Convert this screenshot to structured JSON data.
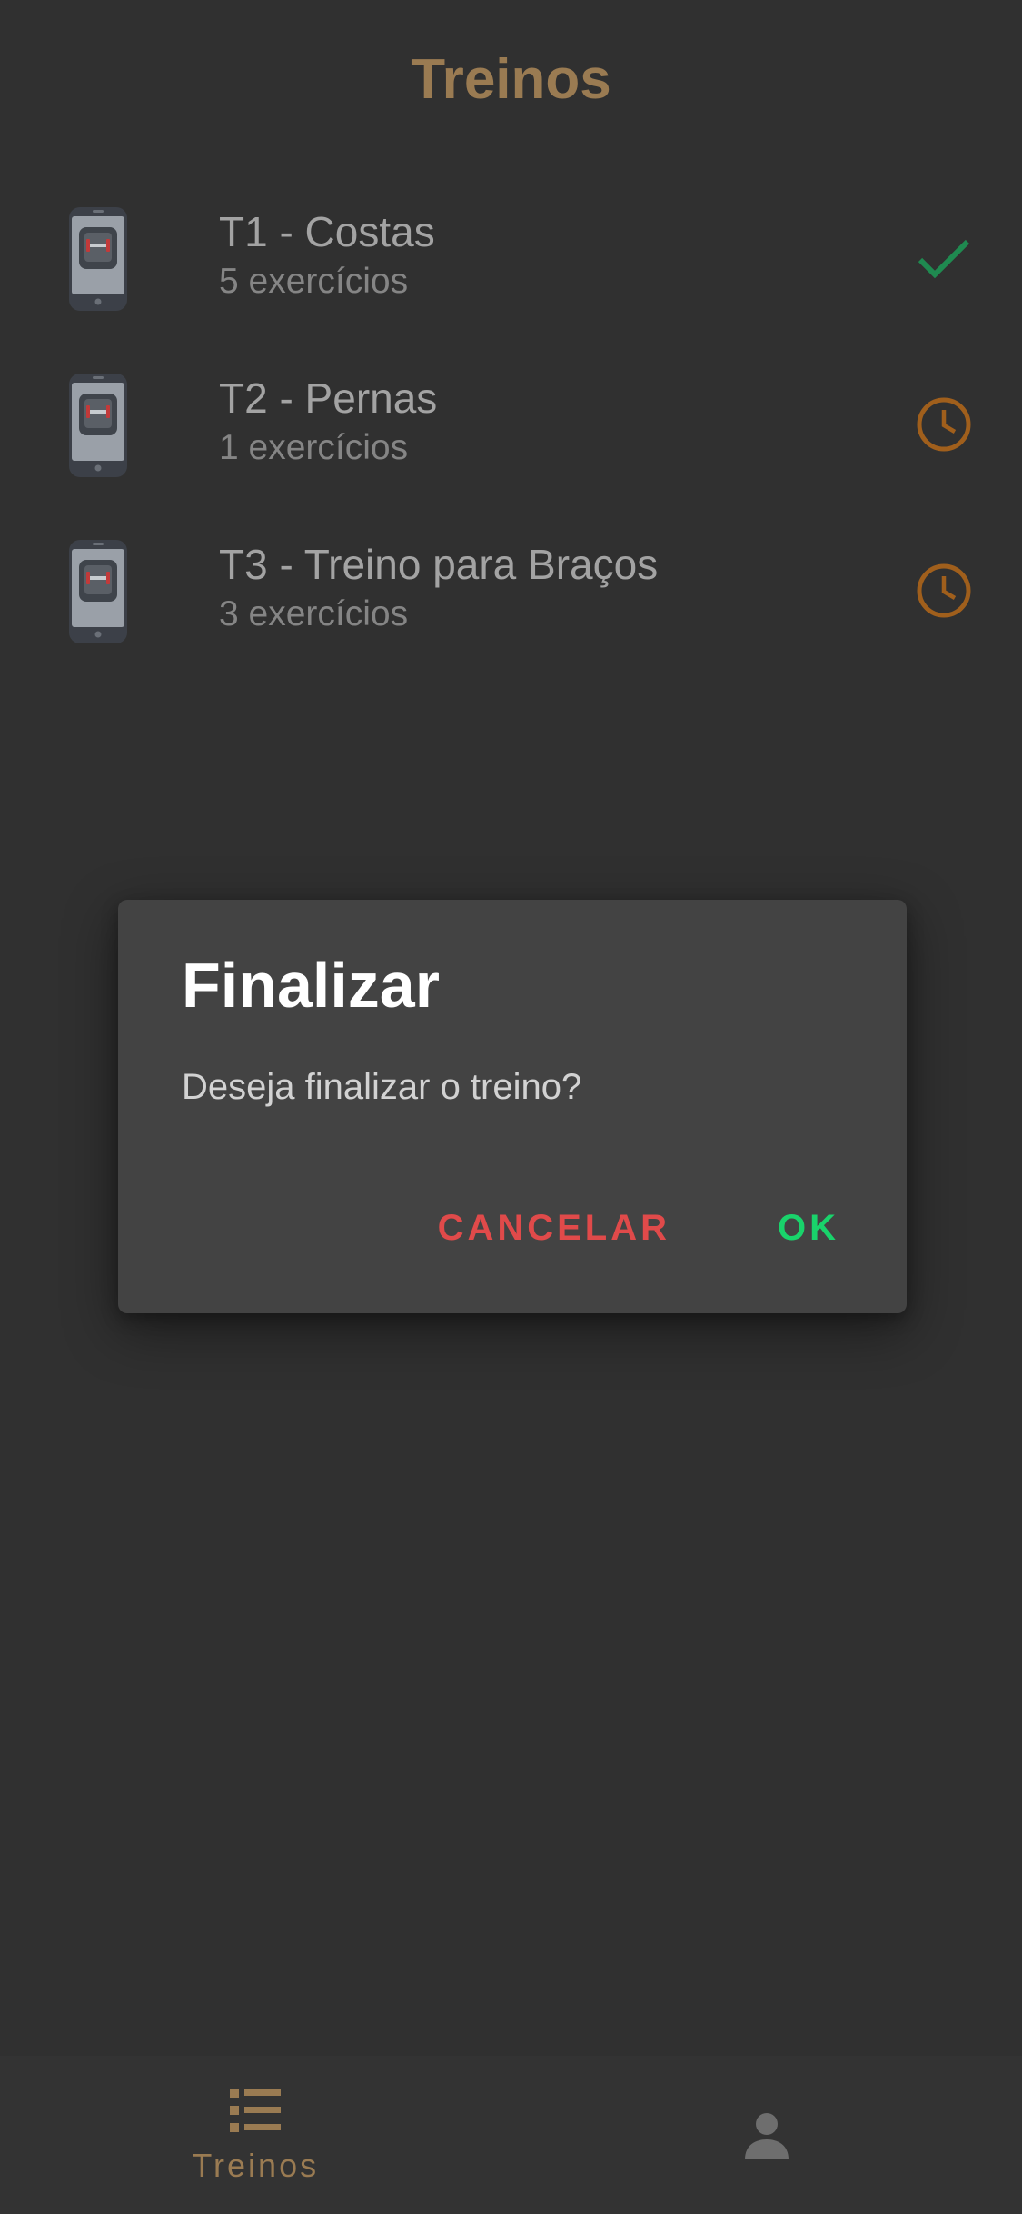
{
  "header": {
    "title": "Treinos"
  },
  "workouts": [
    {
      "title": "T1 - Costas",
      "subtitle": "5 exercícios",
      "status_icon": "check-icon",
      "status_color": "#1f8a50"
    },
    {
      "title": "T2 - Pernas",
      "subtitle": "1 exercícios",
      "status_icon": "clock-icon",
      "status_color": "#a05f1c"
    },
    {
      "title": "T3 - Treino para Braços",
      "subtitle": "3 exercícios",
      "status_icon": "clock-icon",
      "status_color": "#a05f1c"
    }
  ],
  "dialog": {
    "title": "Finalizar",
    "message": "Deseja finalizar o treino?",
    "cancel_label": "CANCELAR",
    "ok_label": "OK"
  },
  "bottom_nav": {
    "items": [
      {
        "label": "Treinos",
        "icon": "list-icon",
        "active": true
      },
      {
        "label": "",
        "icon": "person-icon",
        "active": false
      }
    ]
  },
  "colors": {
    "accent": "#9a7b52",
    "cancel": "#e04a4a",
    "ok": "#19d36b",
    "background": "#303030",
    "dialog": "#434343"
  }
}
